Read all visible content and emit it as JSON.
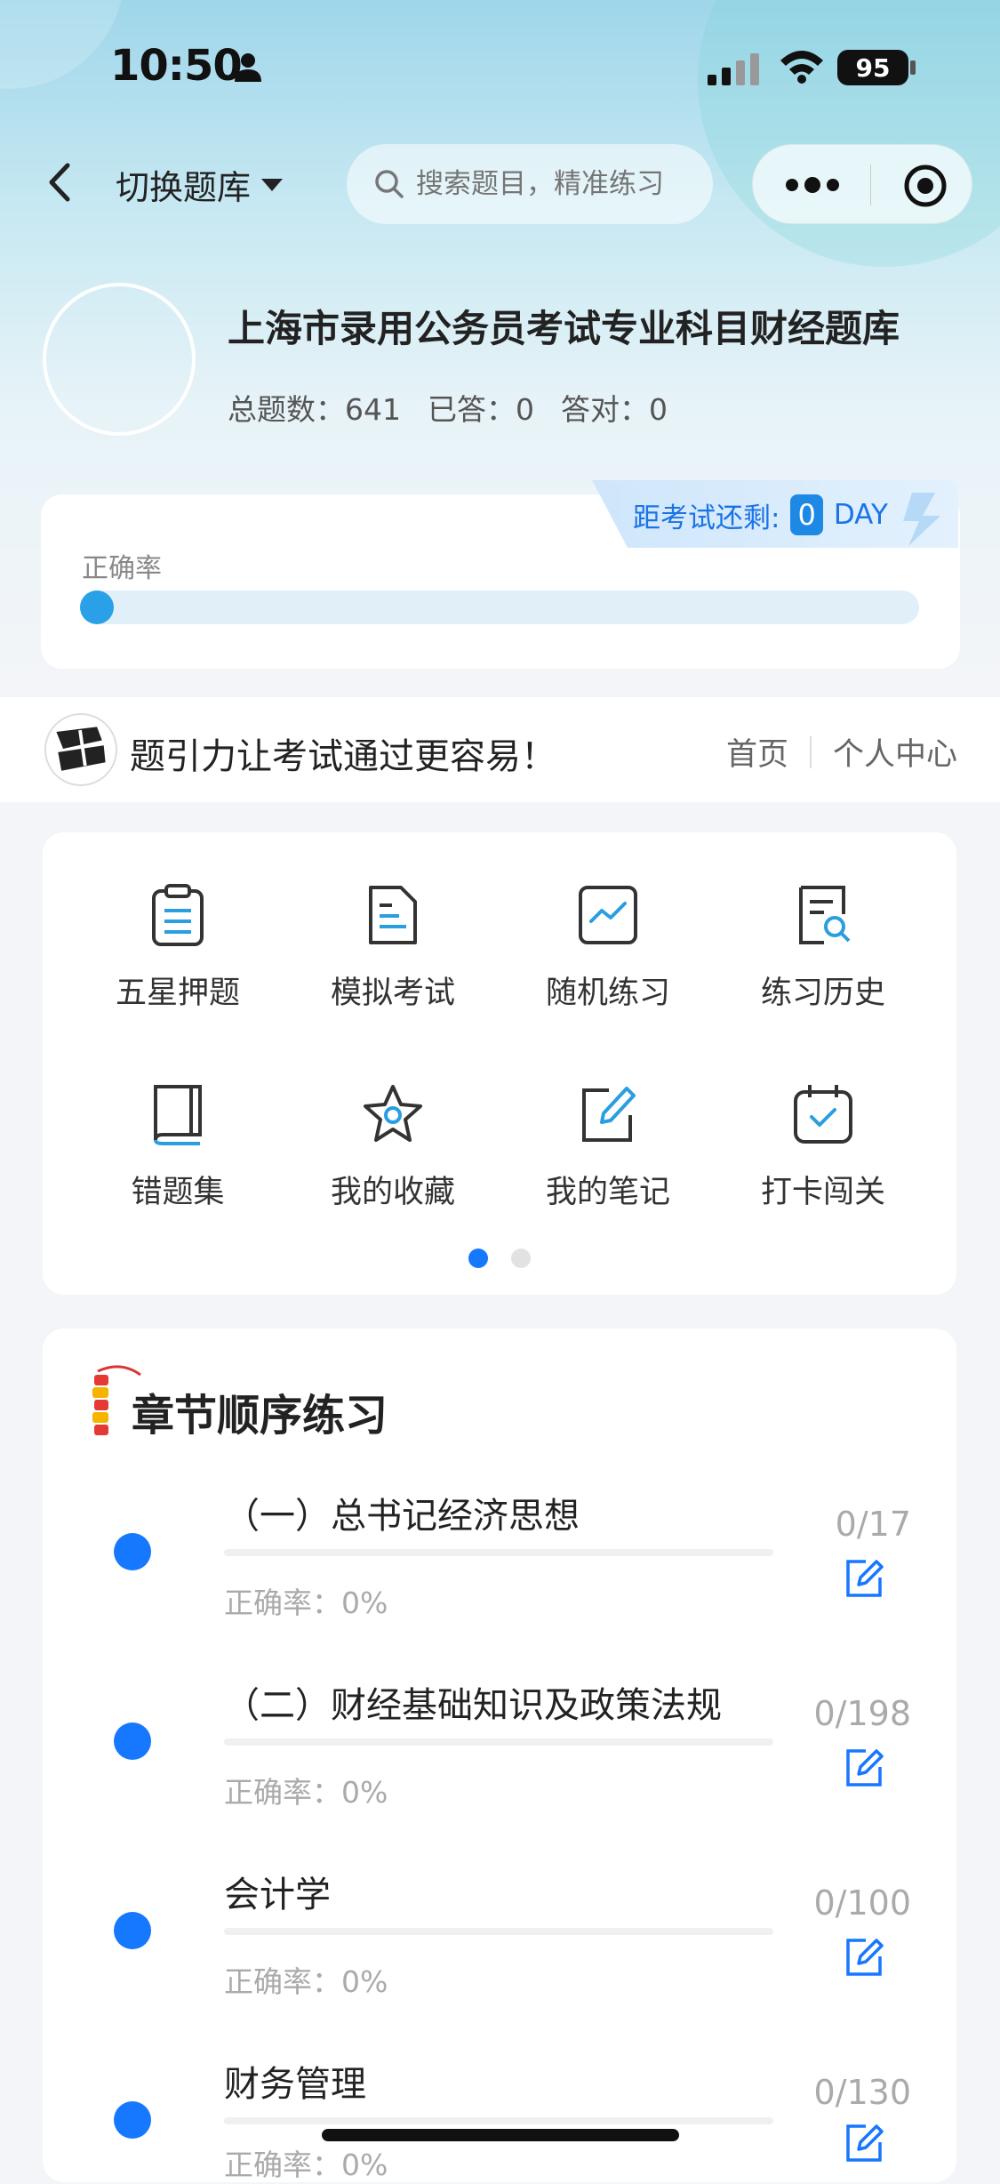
{
  "status_bar": {
    "time": "10:50",
    "battery": "95"
  },
  "nav": {
    "switch_label": "切换题库",
    "search_placeholder": "搜索题目，精准练习"
  },
  "bank": {
    "title": "上海市录用公务员考试专业科目财经题库",
    "total_label": "总题数：641",
    "answered_label": "已答：0",
    "correct_label": "答对：0"
  },
  "exam": {
    "prefix": "距考试还剩:",
    "days": "0",
    "unit": "DAY",
    "accuracy_label": "正确率",
    "accuracy_fraction": 0
  },
  "slogan_bar": {
    "slogan": "题引力让考试通过更容易！",
    "home": "首页",
    "profile": "个人中心"
  },
  "features": [
    {
      "label": "五星押题",
      "icon": "clipboard-icon"
    },
    {
      "label": "模拟考试",
      "icon": "document-icon"
    },
    {
      "label": "随机练习",
      "icon": "chart-icon"
    },
    {
      "label": "练习历史",
      "icon": "history-search-icon"
    },
    {
      "label": "错题集",
      "icon": "book-icon"
    },
    {
      "label": "我的收藏",
      "icon": "star-icon"
    },
    {
      "label": "我的笔记",
      "icon": "note-edit-icon"
    },
    {
      "label": "打卡闯关",
      "icon": "calendar-check-icon"
    }
  ],
  "colors": {
    "accent": "#1677ff",
    "icon_blue": "#2a9ee0"
  },
  "chapters": {
    "title": "章节顺序练习",
    "items": [
      {
        "name": "（一）总书记经济思想",
        "accuracy": "正确率：0%",
        "count": "0/17"
      },
      {
        "name": "（二）财经基础知识及政策法规",
        "accuracy": "正确率：0%",
        "count": "0/198"
      },
      {
        "name": "会计学",
        "accuracy": "正确率：0%",
        "count": "0/100"
      },
      {
        "name": "财务管理",
        "accuracy": "正确率：0%",
        "count": "0/130"
      }
    ]
  }
}
